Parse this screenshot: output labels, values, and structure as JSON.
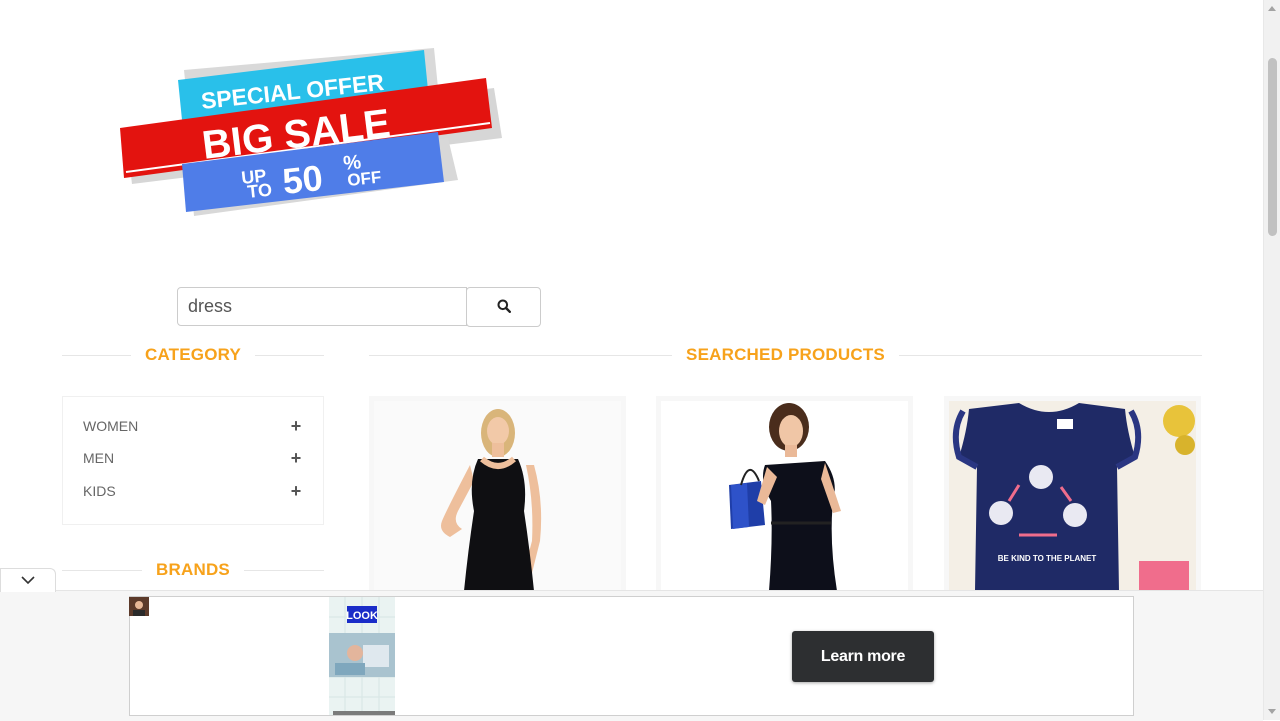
{
  "banner": {
    "line1": "SPECIAL OFFER",
    "line2": "BIG SALE",
    "up": "UP",
    "to": "TO",
    "amount": "50",
    "percent": "%",
    "off": "OFF"
  },
  "search": {
    "value": "dress",
    "icon": "search-icon"
  },
  "sections": {
    "category": "CATEGORY",
    "products": "SEARCHED PRODUCTS",
    "brands": "BRANDS"
  },
  "categories": [
    {
      "label": "WOMEN",
      "icon": "plus-icon"
    },
    {
      "label": "MEN",
      "icon": "plus-icon"
    },
    {
      "label": "KIDS",
      "icon": "plus-icon"
    }
  ],
  "products": [
    {
      "image": "woman-black-tank-dress"
    },
    {
      "image": "woman-black-dress-shopping-bag"
    },
    {
      "image": "kids-navy-tshirt",
      "print": "BE KIND TO THE PLANET"
    }
  ],
  "ad": {
    "button": "Learn more",
    "logo": "LOOK",
    "collapse_icon": "chevron-down-icon"
  },
  "colors": {
    "accent": "#f7a21b",
    "banner_blue": "#29c0ea",
    "banner_red": "#e3130f",
    "banner_lightblue": "#4f7de8",
    "button_dark": "#2d2f31"
  }
}
